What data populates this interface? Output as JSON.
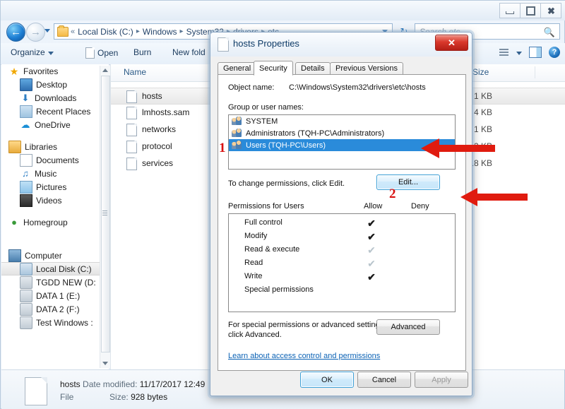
{
  "window": {
    "controls": {
      "minimize": "–",
      "maximize": "□",
      "close": "✕"
    }
  },
  "addressbar": {
    "back_glyph": "←",
    "forward_glyph": "→",
    "chevrons": "«",
    "crumbs": [
      "Local Disk (C:)",
      "Windows",
      "System32",
      "drivers",
      "etc"
    ],
    "separator": "▸",
    "refresh_glyph": "↻"
  },
  "search": {
    "placeholder": "Search etc",
    "icon": "🔍"
  },
  "toolbar": {
    "organize": "Organize",
    "open": "Open",
    "burn": "Burn",
    "new_folder": "New fold",
    "help": "?"
  },
  "navpane": {
    "groups": [
      {
        "label": "Favorites",
        "icon": "star-icon",
        "children": [
          {
            "label": "Desktop",
            "icon": "desktop-icon"
          },
          {
            "label": "Downloads",
            "icon": "downloads-icon"
          },
          {
            "label": "Recent Places",
            "icon": "recent-places-icon"
          },
          {
            "label": "OneDrive",
            "icon": "onedrive-icon"
          }
        ]
      },
      {
        "label": "Libraries",
        "icon": "libraries-icon",
        "children": [
          {
            "label": "Documents",
            "icon": "documents-icon"
          },
          {
            "label": "Music",
            "icon": "music-icon"
          },
          {
            "label": "Pictures",
            "icon": "pictures-icon"
          },
          {
            "label": "Videos",
            "icon": "videos-icon"
          }
        ]
      },
      {
        "label": "Homegroup",
        "icon": "homegroup-icon",
        "children": []
      },
      {
        "label": "Computer",
        "icon": "computer-icon",
        "children": [
          {
            "label": "Local Disk (C:)",
            "icon": "harddisk-icon",
            "selected": true
          },
          {
            "label": "TGDD NEW (D:",
            "icon": "drive-icon"
          },
          {
            "label": "DATA 1 (E:)",
            "icon": "drive-icon"
          },
          {
            "label": "DATA 2 (F:)",
            "icon": "drive-icon"
          },
          {
            "label": "Test Windows :",
            "icon": "drive-icon"
          }
        ]
      }
    ]
  },
  "filelist": {
    "columns": [
      "Name",
      "Size"
    ],
    "rows": [
      {
        "name": "hosts",
        "size": "1 KB",
        "selected": true
      },
      {
        "name": "lmhosts.sam",
        "size": "4 KB",
        "selected": false
      },
      {
        "name": "networks",
        "size": "1 KB",
        "selected": false
      },
      {
        "name": "protocol",
        "size": "2 KB",
        "selected": false
      },
      {
        "name": "services",
        "size": "18 KB",
        "selected": false
      }
    ]
  },
  "details": {
    "file_name": "hosts",
    "date_modified_label": "Date modified:",
    "date_modified_value": "11/17/2017 12:49",
    "type": "File",
    "size_label": "Size:",
    "size_value": "928 bytes"
  },
  "dialog": {
    "title": "hosts Properties",
    "close_label": "✕",
    "tabs": [
      {
        "label": "General",
        "active": false
      },
      {
        "label": "Security",
        "active": true
      },
      {
        "label": "Details",
        "active": false
      },
      {
        "label": "Previous Versions",
        "active": false
      }
    ],
    "object_name_label": "Object name:",
    "object_name_value": "C:\\Windows\\System32\\drivers\\etc\\hosts",
    "group_label": "Group or user names:",
    "groups": [
      {
        "name": "SYSTEM",
        "selected": false
      },
      {
        "name": "Administrators (TQH-PC\\Administrators)",
        "selected": false
      },
      {
        "name": "Users (TQH-PC\\Users)",
        "selected": true
      }
    ],
    "change_hint": "To change permissions, click Edit.",
    "edit_button": "Edit...",
    "permissions_header": "Permissions for Users",
    "allow_header": "Allow",
    "deny_header": "Deny",
    "permissions": [
      {
        "name": "Full control",
        "allow": "check",
        "deny": ""
      },
      {
        "name": "Modify",
        "allow": "check",
        "deny": ""
      },
      {
        "name": "Read & execute",
        "allow": "check-grey",
        "deny": ""
      },
      {
        "name": "Read",
        "allow": "check-grey",
        "deny": ""
      },
      {
        "name": "Write",
        "allow": "check",
        "deny": ""
      },
      {
        "name": "Special permissions",
        "allow": "",
        "deny": ""
      }
    ],
    "check_glyph": "✔",
    "advanced_text_line1": "For special permissions or advanced settings,",
    "advanced_text_line2": "click Advanced.",
    "advanced_button": "Advanced",
    "learn_link": "Learn about access control and permissions",
    "ok_button": "OK",
    "cancel_button": "Cancel",
    "apply_button": "Apply"
  },
  "annotations": {
    "marker_1": "1",
    "marker_2": "2",
    "arrow_color": "#e01b0f"
  }
}
